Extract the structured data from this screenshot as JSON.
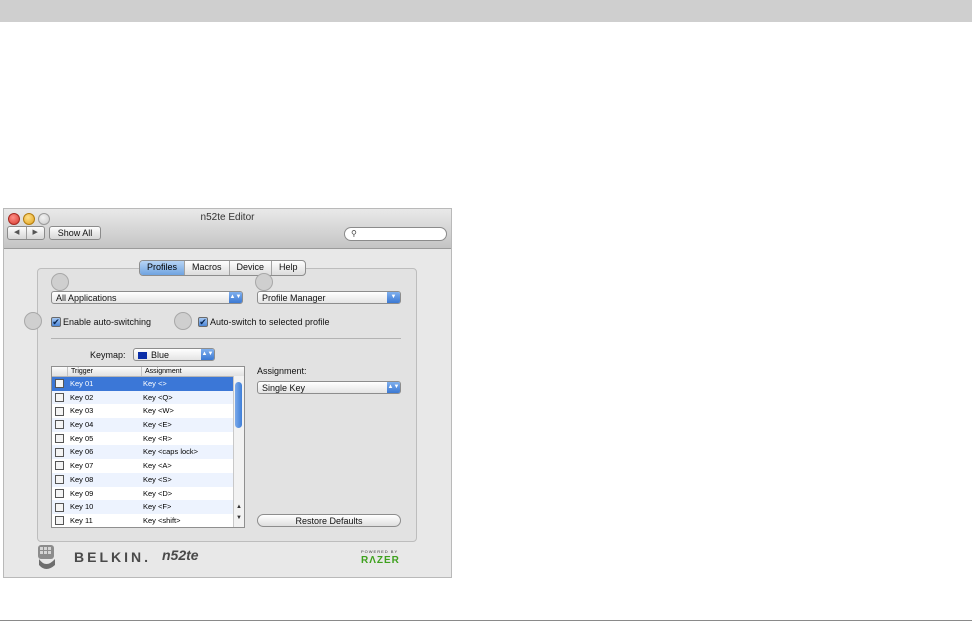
{
  "window": {
    "title": "n52te Editor",
    "nav_back": "◀",
    "nav_forward": "▶",
    "show_all": "Show All",
    "search_placeholder": ""
  },
  "tabs": [
    "Profiles",
    "Macros",
    "Device",
    "Help"
  ],
  "active_tab": "Profiles",
  "profile": {
    "application": "All Applications",
    "manager": "Profile Manager",
    "enable_auto_switching": "Enable auto-switching",
    "auto_switch_selected": "Auto-switch to selected profile",
    "enable_auto_switching_checked": true,
    "auto_switch_selected_checked": true
  },
  "keymap": {
    "label": "Keymap:",
    "value": "Blue",
    "color": "#0b2ea8"
  },
  "table": {
    "headers": [
      "Trigger",
      "Assignment"
    ],
    "rows": [
      {
        "trigger": "Key 01",
        "assignment": "Key <>"
      },
      {
        "trigger": "Key 02",
        "assignment": "Key <Q>"
      },
      {
        "trigger": "Key 03",
        "assignment": "Key <W>"
      },
      {
        "trigger": "Key 04",
        "assignment": "Key <E>"
      },
      {
        "trigger": "Key 05",
        "assignment": "Key <R>"
      },
      {
        "trigger": "Key 06",
        "assignment": "Key <caps lock>"
      },
      {
        "trigger": "Key 07",
        "assignment": "Key <A>"
      },
      {
        "trigger": "Key 08",
        "assignment": "Key <S>"
      },
      {
        "trigger": "Key 09",
        "assignment": "Key <D>"
      },
      {
        "trigger": "Key 10",
        "assignment": "Key <F>"
      },
      {
        "trigger": "Key 11",
        "assignment": "Key <shift>"
      }
    ],
    "selected_index": 0
  },
  "assignment": {
    "label": "Assignment:",
    "value": "Single Key"
  },
  "restore_defaults": "Restore Defaults",
  "footer": {
    "brand": "BELKIN.",
    "model": "n52te",
    "powered_by": "POWERED BY",
    "razer": "RΛZER"
  },
  "colors": {
    "selection": "#3b77d7",
    "razer_green": "#3ea11e"
  }
}
